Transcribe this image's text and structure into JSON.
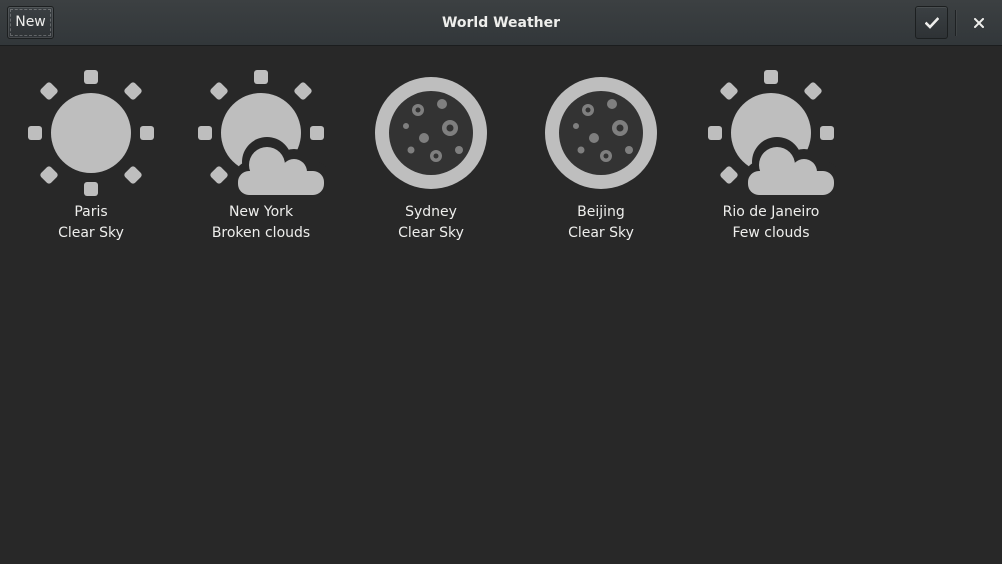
{
  "window": {
    "title": "World Weather"
  },
  "header": {
    "new_label": "New",
    "select_icon": "checkmark-icon",
    "close_icon": "close-icon"
  },
  "locations": [
    {
      "city": "Paris",
      "condition": "Clear Sky",
      "icon": "sun-icon"
    },
    {
      "city": "New York",
      "condition": "Broken clouds",
      "icon": "sun-cloud-icon"
    },
    {
      "city": "Sydney",
      "condition": "Clear Sky",
      "icon": "moon-icon"
    },
    {
      "city": "Beijing",
      "condition": "Clear Sky",
      "icon": "moon-icon"
    },
    {
      "city": "Rio de Janeiro",
      "condition": "Few clouds",
      "icon": "sun-cloud-icon"
    }
  ],
  "colors": {
    "icon": "#bebebe",
    "icon_dark": "#333333",
    "text": "#eeeeec",
    "background": "#282828"
  }
}
